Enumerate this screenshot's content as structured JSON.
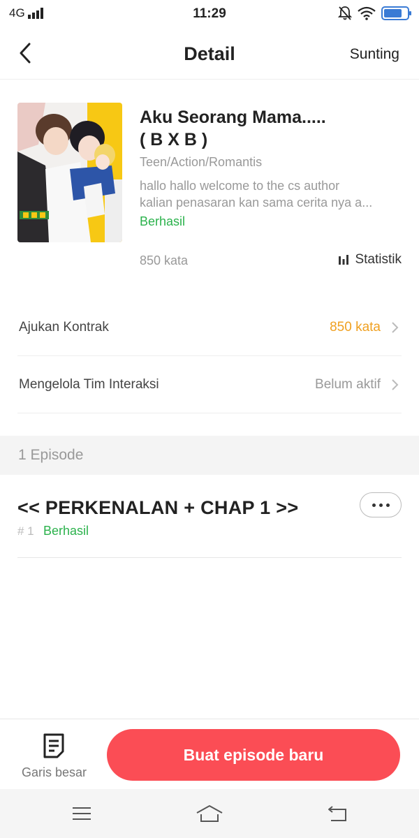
{
  "status_bar": {
    "network": "4G",
    "time": "11:29",
    "battery_level": 0.78
  },
  "header": {
    "title": "Detail",
    "edit_label": "Sunting",
    "back_icon": "chevron-left-icon"
  },
  "book": {
    "title_line1": "Aku Seorang Mama.....",
    "title_line2": "( B X B )",
    "genre": "Teen/Action/Romantis",
    "description_line1": "hallo hallo welcome to the cs author",
    "description_line2": "kalian penasaran kan sama cerita nya  a...",
    "status": "Berhasil",
    "word_count": "850 kata",
    "stats_label": "Statistik"
  },
  "rows": [
    {
      "label": "Ajukan Kontrak",
      "value": "850 kata",
      "value_color": "#f0a020"
    },
    {
      "label": "Mengelola Tim Interaksi",
      "value": "Belum aktif",
      "value_color": "#999999"
    }
  ],
  "episodes": {
    "header": "1 Episode",
    "items": [
      {
        "title": "<< PERKENALAN + CHAP 1 >>",
        "number": "# 1",
        "status": "Berhasil"
      }
    ]
  },
  "bottom_bar": {
    "outline_label": "Garis besar",
    "create_label": "Buat episode baru",
    "accent_color": "#fb4d55"
  },
  "colors": {
    "success": "#2bb24c",
    "warning": "#f0a020",
    "muted": "#999999"
  }
}
